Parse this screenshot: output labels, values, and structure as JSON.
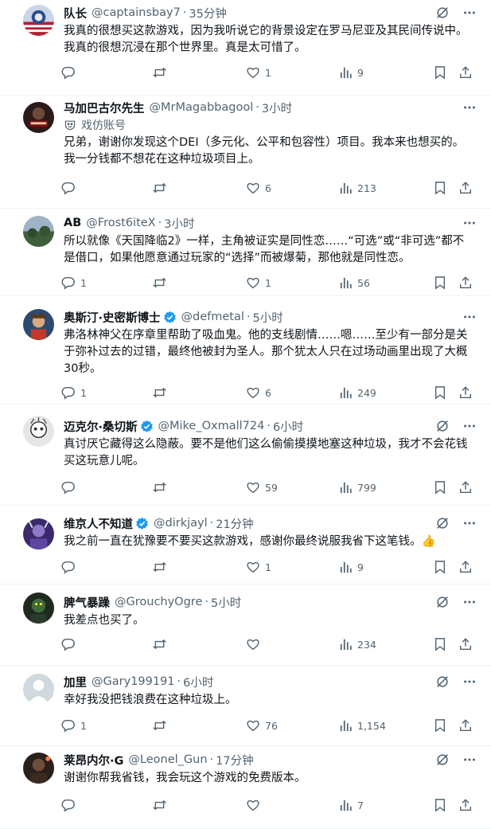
{
  "tweets": [
    {
      "name": "队长",
      "handle": "@captainsbay7",
      "time": "35分钟",
      "verified": false,
      "parody": "",
      "text": "我真的很想买这款游戏，因为我听说它的背景设定在罗马尼亚及其民间传说中。我真的很想沉浸在那个世界里。真是太可惜了。",
      "replies": "",
      "retweets": "",
      "likes": "1",
      "views": "9",
      "grok": true
    },
    {
      "name": "马加巴古尔先生",
      "handle": "@MrMagabbagool",
      "time": "3小时",
      "verified": false,
      "parody": "戏仿账号",
      "text": "兄弟，谢谢你发现这个DEI（多元化、公平和包容性）项目。我本来也想买的。我一分钱都不想花在这种垃圾项目上。",
      "replies": "",
      "retweets": "",
      "likes": "6",
      "views": "213",
      "grok": false
    },
    {
      "name": "AB",
      "handle": "@Frost6iteX",
      "time": "3小时",
      "verified": false,
      "parody": "",
      "text": "所以就像《天国降临2》一样，主角被证实是同性恋……“可选”或“非可选”都不是借口，如果他愿意通过玩家的“选择”而被爆菊，那他就是同性恋。",
      "replies": "1",
      "retweets": "",
      "likes": "1",
      "views": "56",
      "grok": false
    },
    {
      "name": "奥斯汀·史密斯博士",
      "handle": "@defmetal",
      "time": "5小时",
      "verified": true,
      "parody": "",
      "text": "弗洛林神父在序章里帮助了吸血鬼。他的支线剧情……嗯……至少有一部分是关于弥补过去的过错，最终他被封为圣人。那个犹太人只在过场动画里出现了大概30秒。",
      "replies": "1",
      "retweets": "",
      "likes": "6",
      "views": "249",
      "grok": false
    },
    {
      "name": "迈克尔·桑切斯",
      "handle": "@Mike_Oxmall724",
      "time": "6小时",
      "verified": true,
      "parody": "",
      "text": "真讨厌它藏得这么隐蔽。要不是他们这么偷偷摸摸地塞这种垃圾，我才不会花钱买这玩意儿呢。",
      "replies": "",
      "retweets": "",
      "likes": "59",
      "views": "799",
      "grok": true
    },
    {
      "name": "维京人不知道",
      "handle": "@dirkjayl",
      "time": "21分钟",
      "verified": true,
      "parody": "",
      "text": "我之前一直在犹豫要不要买这款游戏，感谢你最终说服我省下这笔钱。👍",
      "replies": "",
      "retweets": "",
      "likes": "1",
      "views": "9",
      "grok": true
    },
    {
      "name": "脾气暴躁",
      "handle": "@GrouchyOgre",
      "time": "5小时",
      "verified": false,
      "parody": "",
      "text": "我差点也买了。",
      "replies": "",
      "retweets": "",
      "likes": "",
      "views": "234",
      "grok": true
    },
    {
      "name": "加里",
      "handle": "@Gary199191",
      "time": "6小时",
      "verified": false,
      "parody": "",
      "text": "幸好我没把钱浪费在这种垃圾上。",
      "replies": "1",
      "retweets": "",
      "likes": "76",
      "views": "1,154",
      "grok": true
    },
    {
      "name": "莱昂内尔·G",
      "handle": "@Leonel_Gun",
      "time": "17分钟",
      "verified": false,
      "parody": "",
      "text": "谢谢你帮我省钱，我会玩这个游戏的免费版本。",
      "replies": "",
      "retweets": "",
      "likes": "",
      "views": "7",
      "grok": true
    }
  ],
  "colors": {
    "text": "#0f1419",
    "secondary": "#536471",
    "verified": "#1d9bf0",
    "divider": "#eff3f4"
  },
  "icons": [
    "grok-icon",
    "more-icon",
    "reply-icon",
    "retweet-icon",
    "like-icon",
    "views-icon",
    "bookmark-icon",
    "share-icon",
    "verified-icon",
    "parody-icon"
  ]
}
